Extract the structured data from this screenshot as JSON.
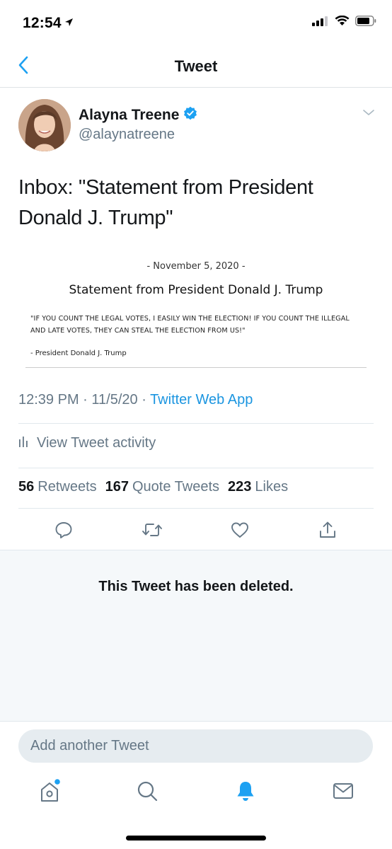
{
  "status_bar": {
    "time": "12:54"
  },
  "nav": {
    "title": "Tweet"
  },
  "author": {
    "name": "Alayna Treene",
    "handle": "@alaynatreene"
  },
  "tweet": {
    "text_line1": "Inbox: \"Statement from President",
    "text_line2": "Donald J. Trump\""
  },
  "attachment": {
    "date": "- November 5, 2020 -",
    "title": "Statement from President Donald J. Trump",
    "quote": "\"IF YOU COUNT THE LEGAL VOTES, I EASILY WIN THE ELECTION! IF YOU COUNT THE ILLEGAL AND LATE VOTES, THEY CAN STEAL THE ELECTION FROM US!\"",
    "signature": "- President Donald J. Trump"
  },
  "meta": {
    "time": "12:39 PM",
    "date": "11/5/20",
    "app": "Twitter Web App"
  },
  "activity": {
    "label": "View Tweet activity"
  },
  "stats": {
    "retweets_count": "56",
    "retweets_label": "Retweets",
    "quotes_count": "167",
    "quotes_label": "Quote Tweets",
    "likes_count": "223",
    "likes_label": "Likes"
  },
  "deleted": {
    "message": "This Tweet has been deleted."
  },
  "composer": {
    "placeholder": "Add another Tweet"
  },
  "colors": {
    "accent": "#1da1f2",
    "link": "#1b95e0",
    "secondary_text": "#657786",
    "deleted_bg": "#f5f8fa",
    "verified": "#1da1f2"
  },
  "icons": [
    "location-arrow-icon",
    "signal-icon",
    "wifi-icon",
    "battery-icon",
    "back-chevron-icon",
    "verified-badge-icon",
    "chevron-down-icon",
    "activity-bars-icon",
    "reply-icon",
    "retweet-icon",
    "like-icon",
    "share-icon",
    "home-icon",
    "search-icon",
    "notifications-icon",
    "messages-icon"
  ]
}
